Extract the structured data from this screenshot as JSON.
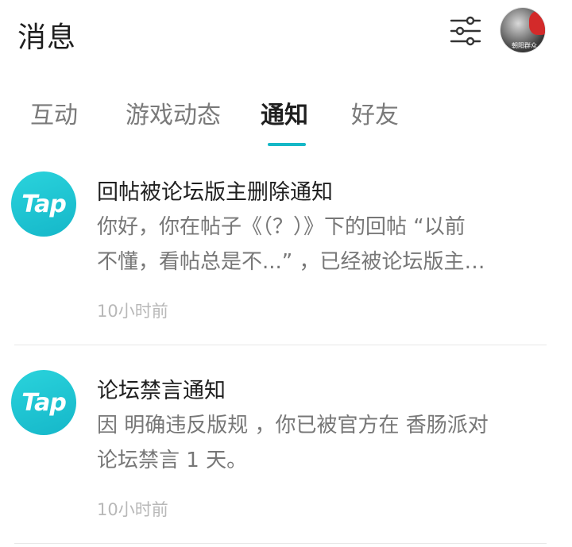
{
  "header": {
    "title": "消息",
    "filter_icon": "sliders-icon",
    "avatar_text": "朝阳群众"
  },
  "tabs": [
    {
      "label": "互动",
      "active": false
    },
    {
      "label": "游戏动态",
      "active": false
    },
    {
      "label": "通知",
      "active": true
    },
    {
      "label": "好友",
      "active": false
    }
  ],
  "accent_color": "#16b8c7",
  "notifications": [
    {
      "logo_text": "Tap",
      "title": "回帖被论坛版主删除通知",
      "body_line1": "你好，你在帖子《（？）》下的回帖 “以前",
      "body_line2": "不懂，看帖总是不...” ，已经被论坛版主…",
      "time": "10小时前"
    },
    {
      "logo_text": "Tap",
      "title": "论坛禁言通知",
      "body_line1": "因 明确违反版规 ，你已被官方在 香肠派对",
      "body_line2": "论坛禁言 1 天。",
      "time": "10小时前"
    }
  ]
}
